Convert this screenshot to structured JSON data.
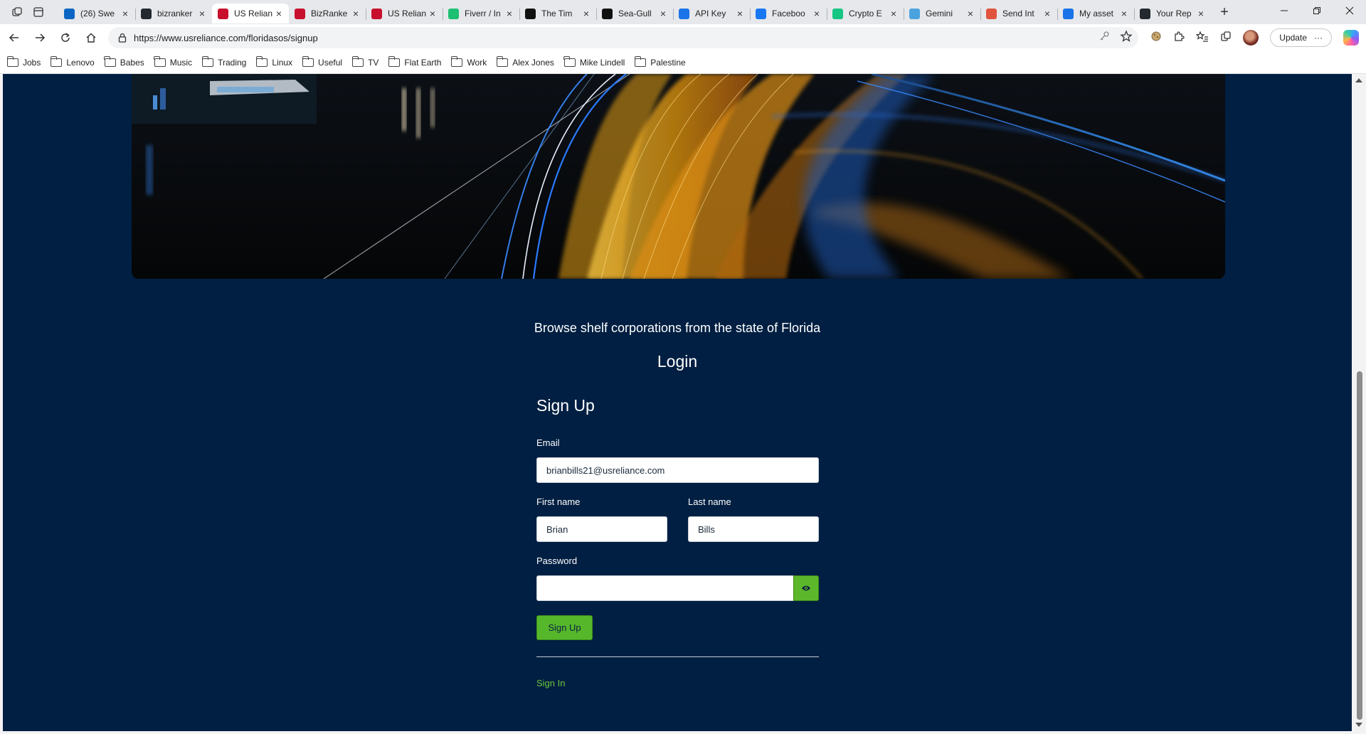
{
  "browser": {
    "tabs": [
      {
        "title": "(26) Swe",
        "favicon_color": "#0a66c2",
        "icon": "linkedin-icon",
        "active": false
      },
      {
        "title": "bizranker",
        "favicon_color": "#24292f",
        "icon": "github-icon",
        "active": false
      },
      {
        "title": "US Relian",
        "favicon_color": "#c8102e",
        "icon": "flag-icon",
        "active": true
      },
      {
        "title": "BizRanke",
        "favicon_color": "#c8102e",
        "icon": "flag-icon",
        "active": false
      },
      {
        "title": "US Relian",
        "favicon_color": "#c8102e",
        "icon": "flag-icon",
        "active": false
      },
      {
        "title": "Fiverr / In",
        "favicon_color": "#1dbf73",
        "icon": "fiverr-icon",
        "active": false
      },
      {
        "title": "The Tim",
        "favicon_color": "#111111",
        "icon": "amazon-icon",
        "active": false
      },
      {
        "title": "Sea-Gull",
        "favicon_color": "#111111",
        "icon": "openai-icon",
        "active": false
      },
      {
        "title": "API Key",
        "favicon_color": "#1a73e8",
        "icon": "c-logo-icon",
        "active": false
      },
      {
        "title": "Faceboo",
        "favicon_color": "#1877f2",
        "icon": "facebook-icon",
        "active": false
      },
      {
        "title": "Crypto E",
        "favicon_color": "#16c784",
        "icon": "coinmarketcap-icon",
        "active": false
      },
      {
        "title": "Gemini",
        "favicon_color": "#4aa3df",
        "icon": "gemini-icon",
        "active": false
      },
      {
        "title": "Send Int",
        "favicon_color": "#e0533c",
        "icon": "send-icon",
        "active": false
      },
      {
        "title": "My asset",
        "favicon_color": "#1a73e8",
        "icon": "c-logo-icon",
        "active": false
      },
      {
        "title": "Your Rep",
        "favicon_color": "#24292f",
        "icon": "github-icon",
        "active": false
      }
    ],
    "url": "https://www.usreliance.com/floridasos/signup",
    "update_label": "Update",
    "bookmarks": [
      "Jobs",
      "Lenovo",
      "Babes",
      "Music",
      "Trading",
      "Linux",
      "Useful",
      "TV",
      "Flat Earth",
      "Work",
      "Alex Jones",
      "Mike Lindell",
      "Palestine"
    ]
  },
  "page": {
    "subtitle": "Browse shelf corporations from the state of Florida",
    "login_heading": "Login",
    "signup_heading": "Sign Up",
    "email_label": "Email",
    "email_value": "brianbills21@usreliance.com",
    "first_name_label": "First name",
    "first_name_value": "Brian",
    "last_name_label": "Last name",
    "last_name_value": "Bills",
    "password_label": "Password",
    "password_value": "",
    "signup_button": "Sign Up",
    "signin_link": "Sign In"
  },
  "colors": {
    "page_background": "#001f42",
    "accent_green": "#56b72b",
    "link_green": "#6cc63a"
  }
}
